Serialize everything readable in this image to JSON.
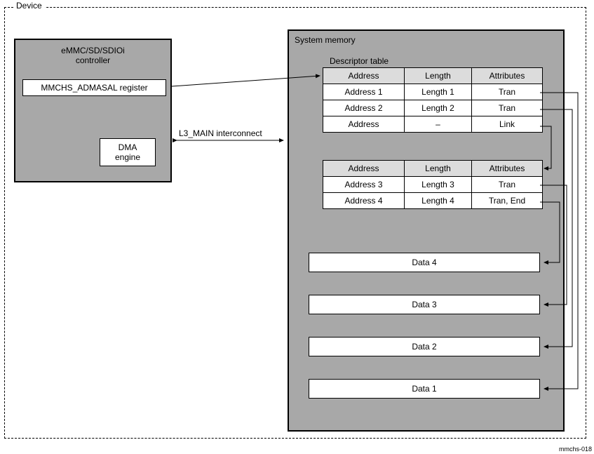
{
  "device_label": "Device",
  "controller": {
    "title_line1": "eMMC/SD/SDIOi",
    "title_line2": "controller",
    "register_label": "MMCHS_ADMASAL register",
    "dma_line1": "DMA",
    "dma_line2": "engine"
  },
  "interconnect_label": "L3_MAIN interconnect",
  "sysmem": {
    "title": "System memory",
    "descriptor_table_label": "Descriptor table",
    "table1": {
      "head": {
        "addr": "Address",
        "len": "Length",
        "attr": "Attributes"
      },
      "rows": [
        {
          "addr": "Address 1",
          "len": "Length 1",
          "attr": "Tran"
        },
        {
          "addr": "Address 2",
          "len": "Length 2",
          "attr": "Tran"
        },
        {
          "addr": "Address",
          "len": "–",
          "attr": "Link"
        }
      ]
    },
    "table2": {
      "head": {
        "addr": "Address",
        "len": "Length",
        "attr": "Attributes"
      },
      "rows": [
        {
          "addr": "Address 3",
          "len": "Length 3",
          "attr": "Tran"
        },
        {
          "addr": "Address 4",
          "len": "Length 4",
          "attr": "Tran, End"
        }
      ]
    },
    "data_blocks": {
      "d4": "Data 4",
      "d3": "Data 3",
      "d2": "Data 2",
      "d1": "Data 1"
    }
  },
  "figure_id": "mmchs-018",
  "chart_data": {
    "type": "table",
    "title": "ADMA descriptor table and data buffer layout",
    "tables": [
      {
        "columns": [
          "Address",
          "Length",
          "Attributes"
        ],
        "rows": [
          [
            "Address 1",
            "Length 1",
            "Tran"
          ],
          [
            "Address 2",
            "Length 2",
            "Tran"
          ],
          [
            "Address",
            "–",
            "Link"
          ]
        ]
      },
      {
        "columns": [
          "Address",
          "Length",
          "Attributes"
        ],
        "rows": [
          [
            "Address 3",
            "Length 3",
            "Tran"
          ],
          [
            "Address 4",
            "Length 4",
            "Tran, End"
          ]
        ]
      }
    ],
    "data_buffers": [
      "Data 1",
      "Data 2",
      "Data 3",
      "Data 4"
    ],
    "links": [
      {
        "from": "MMCHS_ADMASAL register",
        "to": "Descriptor table (first)"
      },
      {
        "from": "DMA engine",
        "to": "System memory",
        "via": "L3_MAIN interconnect",
        "bidirectional": true
      },
      {
        "from": "Address 1 (Tran)",
        "to": "Data 1"
      },
      {
        "from": "Address 2 (Tran)",
        "to": "Data 2"
      },
      {
        "from": "Address (Link)",
        "to": "Descriptor table (second)"
      },
      {
        "from": "Address 3 (Tran)",
        "to": "Data 3"
      },
      {
        "from": "Address 4 (Tran, End)",
        "to": "Data 4"
      }
    ]
  }
}
